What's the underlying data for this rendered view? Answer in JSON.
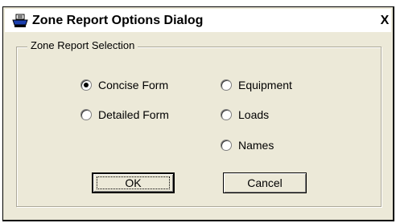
{
  "window": {
    "title": "Zone Report Options Dialog",
    "close_label": "X",
    "icon": "printer-icon"
  },
  "group": {
    "label": "Zone Report Selection"
  },
  "options": [
    {
      "label": "Concise Form",
      "checked": true
    },
    {
      "label": "Detailed Form",
      "checked": false
    },
    {
      "label": "Equipment",
      "checked": false
    },
    {
      "label": "Loads",
      "checked": false
    },
    {
      "label": "Names",
      "checked": false
    }
  ],
  "buttons": {
    "ok_label": "OK",
    "cancel_label": "Cancel"
  }
}
